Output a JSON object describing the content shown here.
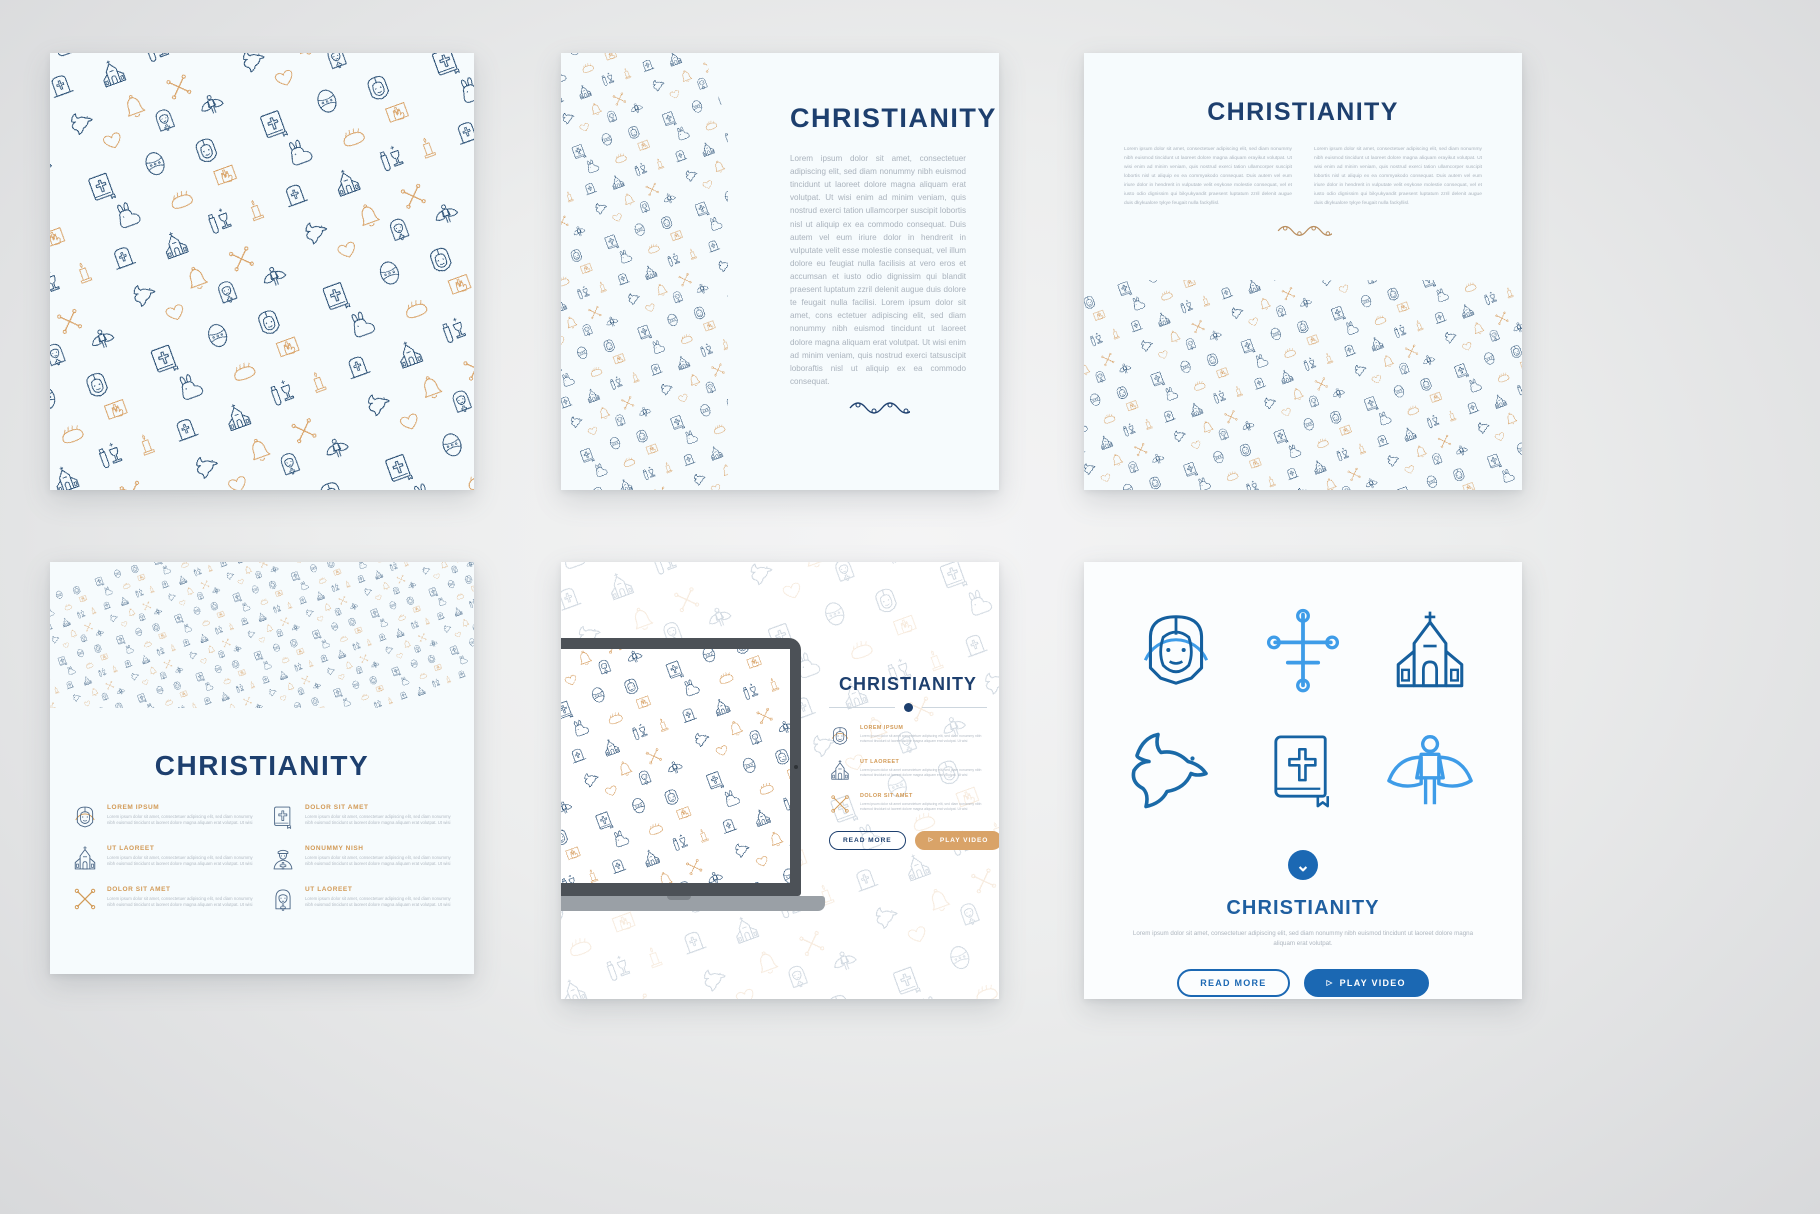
{
  "meta": {
    "brand_title": "CHRISTIANITY",
    "accent_navy": "#1d3f6e",
    "accent_tan": "#d9a368",
    "accent_blue": "#1b68b3",
    "card_bg": "#f6fbfd",
    "page_bg": "#ececed"
  },
  "card1": {
    "name": "full-pattern-card"
  },
  "card2": {
    "title": "CHRISTIANITY",
    "body": "Lorem ipsum dolor sit amet, consectetuer adipiscing elit, sed diam nonummy nibh euismod tincidunt ut laoreet dolore magna aliquam erat volutpat. Ut wisi enim ad minim veniam, quis nostrud exerci tation ullamcorper suscipit lobortis nisl ut aliquip ex ea commodo consequat. Duis autem vel eum iriure dolor in hendrerit in vulputate velit esse molestie consequat, vel illum dolore eu feugiat nulla facilisis at vero eros et accumsan et iusto odio dignissim qui blandit praesent luptatum zzril delenit augue duis dolore te feugait nulla facilisi. Lorem ipsum dolor sit amet, cons ectetuer adipiscing elit, sed diam nonummy nibh euismod tincidunt ut laoreet dolore magna aliquam erat volutpat. Ut wisi enim ad minim veniam, quis nostrud exerci tatsuscipit loboraftis nisl ut aliquip ex ea commodo consequat."
  },
  "card3": {
    "title": "CHRISTIANITY",
    "column_left": "Lorem ipsum dolor sit amet, consectetuer adipiscing elit, sed diam nonummy nibh euismod tincidunt ut laoreet dolore magna aliquam erayikut volutpat. Ut wisi enim ad minim veniam, quis nostrud exerci tation ullamcorper suscipit lobortis nisl ut aliquip ex ea commyakodo consequat. Duis autem vel eum iriure dolor in hendrerit in vulputate velit esykose molestie consequat, vel  et iusto odio dignissim qui bikyukyandit praesent luptatum zzril delenit augue duis dkykualore tykye feugait nulla fackyllisl.",
    "column_right": "Lorem ipsum dolor sit amet, consectetuer adipiscing elit, sed diam nonummy nibh euismod tincidunt ut laoreet dolore magna aliquam erayikut volutpat. Ut wisi enim ad minim veniam, quis nostrud exerci tation ullamcorper suscipit lobortis nisl ut aliquip ex ea commyakodo consequat. Duis autem vel eum iriure dolor in hendrerit in vulputate velit esykose molestie consequat, vel  et iusto odio dignissim qui bikyukyandit praesent luptatum zzril delenit augue duis dkykualore tykye feugait nulla fackyllisl."
  },
  "card4": {
    "title": "CHRISTIANITY",
    "features": [
      {
        "icon": "jesus-icon",
        "heading": "LOREM IPSUM",
        "text": "Lorem ipsum dolor sit amet, consectetuer adipiscing elit, sed diam nonummy nibh euismod tincidunt ut laoreet dolore magna aliquam erat volutpat. Ut wisi"
      },
      {
        "icon": "church-icon",
        "heading": "UT LAOREET",
        "text": "Lorem ipsum dolor sit amet, consectetuer adipiscing elit, sed diam nonummy nibh euismod tincidunt ut laoreet dolore magna aliquam erat volutpat. Ut wisi"
      },
      {
        "icon": "cross-icon",
        "heading": "DOLOR SIT AMET",
        "text": "Lorem ipsum dolor sit amet, consectetuer adipiscing elit, sed diam nonummy nibh euismod tincidunt ut laoreet dolore magna aliquam erat volutpat. Ut wisi"
      },
      {
        "icon": "bible-icon",
        "heading": "DOLOR SIT AMET",
        "text": "Lorem ipsum dolor sit amet, consectetuer adipiscing elit, sed diam nonummy nibh euismod tincidunt ut laoreet dolore magna aliquam erat volutpat. Ut wisi"
      },
      {
        "icon": "priest-icon",
        "heading": "NONUMMY NISH",
        "text": "Lorem ipsum dolor sit amet, consectetuer adipiscing elit, sed diam nonummy nibh euismod tincidunt ut laoreet dolore magna aliquam erat volutpat. Ut wisi"
      },
      {
        "icon": "nun-icon",
        "heading": "UT LAOREET",
        "text": "Lorem ipsum dolor sit amet, consectetuer adipiscing elit, sed diam nonummy nibh euismod tincidunt ut laoreet dolore magna aliquam erat volutpat. Ut wisi"
      }
    ]
  },
  "card5": {
    "title": "CHRISTIANITY",
    "features": [
      {
        "icon": "jesus-icon",
        "heading": "LOREM IPSUM",
        "text": "Lorem ipsum dolor sit amet consectetuer adipiscing elit, sed diam nonummy nibh euismod tincidunt ut laoreet dolore magna aliquam erat volutpat. Ut wisi"
      },
      {
        "icon": "church-icon",
        "heading": "UT LAOREET",
        "text": "Lorem ipsum dolor sit amet consectetuer adipiscing elit, sed diam nonummy nibh euismod tincidunt ut laoreet dolore magna aliquam erat volutpat. Ut wisi"
      },
      {
        "icon": "cross-icon",
        "heading": "DOLOR SIT AMET",
        "text": "Lorem ipsum dolor sit amet consectetuer adipiscing elit, sed diam nonummy nibh euismod tincidunt ut laoreet dolore magna aliquam erat volutpat. Ut wisi"
      }
    ],
    "read_more": "READ MORE",
    "play_video": "PLAY VIDEO",
    "play_glyph": "▷"
  },
  "card6": {
    "title": "CHRISTIANITY",
    "body": "Lorem ipsum dolor sit amet, consectetuer adipiscing elit, sed diam nonummy nibh euismod tincidunt ut laoreet dolore magna aliquam erat volutpat.",
    "icons": [
      "jesus-icon",
      "orthodox-cross-icon",
      "church-icon",
      "dove-icon",
      "bible-icon",
      "angel-icon"
    ],
    "scroll_glyph": "⌄",
    "read_more": "READ MORE",
    "play_video": "PLAY VIDEO",
    "play_glyph": "▷"
  }
}
